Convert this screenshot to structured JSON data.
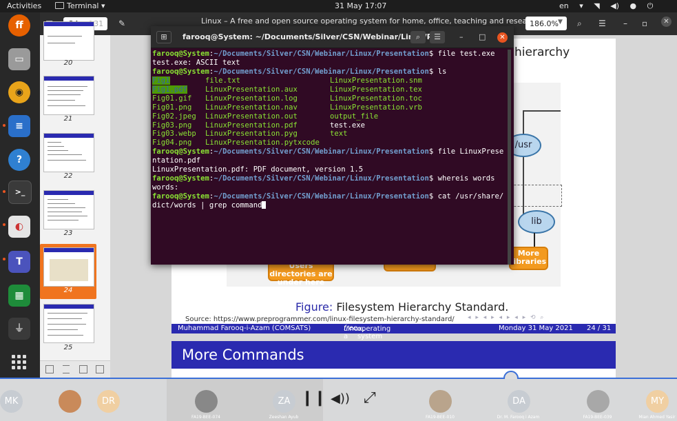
{
  "topbar": {
    "activities": "Activities",
    "app_name": "Terminal",
    "clock": "31 May  17:07",
    "language": "en"
  },
  "evince": {
    "page_current": "24",
    "page_total": "of 31",
    "window_title": "Linux – A free and open source operating system for home, office, teaching and research",
    "zoom": "186.0%"
  },
  "sidebar": {
    "pages": [
      "20",
      "21",
      "22",
      "23",
      "24",
      "25"
    ],
    "selected": "24"
  },
  "slide": {
    "title_fragment": "hierarchy",
    "nodes": {
      "usr": "/usr",
      "lib": "lib",
      "more_libraries": "More libraries",
      "users_directories": "Users directories are under here"
    },
    "figure_label": "Figure:",
    "figure_caption": "Filesystem Hierarchy Standard.",
    "source": "Source: https://www.preprogrammer.com/linux-filesystem-hierarchy-standard/",
    "footer_author": "Muhammad Farooq-i-Azam (COMSATS)",
    "footer_title_pre": "Linux, a ",
    "footer_title_em": "free",
    "footer_title_post": " operating system",
    "footer_date": "Monday 31 May 2021",
    "footer_page": "24 / 31"
  },
  "next_slide": {
    "title": "More Commands"
  },
  "terminal": {
    "title": "farooq@System: ~/Documents/Silver/CSN/Webinar/Linux/Pr...",
    "prompt_user": "farooq@System",
    "prompt_path": "~/Documents/Silver/CSN/Webinar/Linux/Presentation",
    "cmd_file_test": "file test.exe",
    "out_file_test": "test.exe: ASCII text",
    "cmd_ls": "ls",
    "ls_col1": [
      "Fig1",
      "Fig1.pdf",
      "Fig01.gif",
      "Fig01.png",
      "Fig02.jpeg",
      "Fig03.png",
      "Fig03.webp",
      "Fig04.png"
    ],
    "ls_col2": [
      "file.txt",
      "LinuxPresentation.aux",
      "LinuxPresentation.log",
      "LinuxPresentation.nav",
      "LinuxPresentation.out",
      "LinuxPresentation.pdf",
      "LinuxPresentation.pyg",
      "LinuxPresentation.pytxcode"
    ],
    "ls_col3": [
      "LinuxPresentation.snm",
      "LinuxPresentation.tex",
      "LinuxPresentation.toc",
      "LinuxPresentation.vrb",
      "output_file",
      "test.exe",
      "text",
      ""
    ],
    "cmd_file_linux_a": "file LinuxPrese",
    "cmd_file_linux_b": "ntation.pdf",
    "out_file_linux": "LinuxPresentation.pdf: PDF document, version 1.5",
    "cmd_whereis": "whereis words",
    "out_whereis": "words:",
    "cmd_cat_a": "cat /usr/share/",
    "cmd_cat_b": "dict/words | grep command"
  },
  "call": {
    "participants": [
      {
        "initials": "MK",
        "color": "#c7ccd2",
        "name": ""
      },
      {
        "initials": "",
        "color": "#c98a5a",
        "name": ""
      },
      {
        "initials": "DR",
        "color": "#f0cfa2",
        "name": ""
      },
      {
        "initials": "",
        "color": "#888888",
        "name": "FA19-BEE-074"
      },
      {
        "initials": "ZA",
        "color": "#c7ccd2",
        "name": "Zeeshan Ayub"
      },
      {
        "initials": "",
        "color": "#b9a48c",
        "name": "FA19-BEE-010"
      },
      {
        "initials": "DA",
        "color": "#c7ccd2",
        "name": "Dr. M. Farooq i Azam"
      },
      {
        "initials": "",
        "color": "#a8a8a8",
        "name": "FA19-BEE-039"
      },
      {
        "initials": "MY",
        "color": "#f0cfa2",
        "name": "Mian Ahmed Yasir"
      }
    ]
  },
  "colors": {
    "accent": "#e95420",
    "beamer_blue": "#2a2ab0",
    "terminal_bg": "#300a24",
    "call_line": "#3a6fd8"
  }
}
